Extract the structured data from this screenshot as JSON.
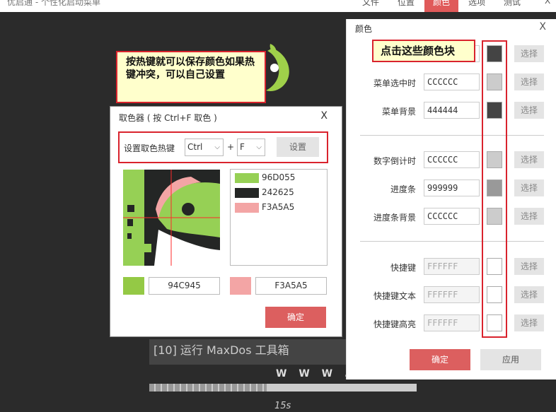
{
  "app": {
    "title": "优启通 - 个性化启动菜单",
    "menu": [
      "文件",
      "位置",
      "颜色",
      "选项",
      "测试"
    ],
    "close_glyph": "X",
    "active_tab": "颜色"
  },
  "preview": {
    "item_text": "[10] 运行 MaxDos 工具箱",
    "url_text": "W W W . I T",
    "countdown": "15s",
    "progress_fraction": 0.44,
    "logo_color": "#9fd04a"
  },
  "callouts": {
    "hotkey_hint": "按热键就可以保存颜色如果热键冲突，可以自己设置",
    "swatch_hint": "点击这些颜色块"
  },
  "color_panel": {
    "title": "颜色",
    "close": "X",
    "rows": [
      {
        "label": "",
        "value": "",
        "swatch": "#444444",
        "button": "选择"
      },
      {
        "label": "菜单选中时",
        "value": "CCCCCC",
        "swatch": "#cccccc",
        "button": "选择"
      },
      {
        "label": "菜单背景",
        "value": "444444",
        "swatch": "#444444",
        "button": "选择"
      },
      {
        "label": "数字倒计时",
        "value": "CCCCCC",
        "swatch": "#cccccc",
        "button": "选择"
      },
      {
        "label": "进度条",
        "value": "999999",
        "swatch": "#999999",
        "button": "选择"
      },
      {
        "label": "进度条背景",
        "value": "CCCCCC",
        "swatch": "#cccccc",
        "button": "选择"
      },
      {
        "label": "快捷键",
        "value": "FFFFFF",
        "swatch": "#ffffff",
        "button": "选择"
      },
      {
        "label": "快捷键文本",
        "value": "FFFFFF",
        "swatch": "#ffffff",
        "button": "选择"
      },
      {
        "label": "快捷键高亮",
        "value": "FFFFFF",
        "swatch": "#ffffff",
        "button": "选择"
      }
    ],
    "ok": "确定",
    "apply": "应用"
  },
  "picker": {
    "title": "取色器 ( 按 Ctrl+F 取色 )",
    "close": "X",
    "hotkey_label": "设置取色热键",
    "modifier": "Ctrl",
    "key": "F",
    "plus": "+",
    "set_button": "设置",
    "history": [
      {
        "color": "#96D055",
        "label": "96D055"
      },
      {
        "color": "#242625",
        "label": "242625"
      },
      {
        "color": "#F3A5A5",
        "label": "F3A5A5"
      }
    ],
    "current_left": {
      "color": "#94C945",
      "label": "94C945"
    },
    "current_right": {
      "color": "#F3A5A5",
      "label": "F3A5A5"
    },
    "ok": "确定"
  },
  "colors": {
    "accent": "#dc5f5f",
    "highlight_border": "#d9232d",
    "background": "#2b2b2b"
  }
}
